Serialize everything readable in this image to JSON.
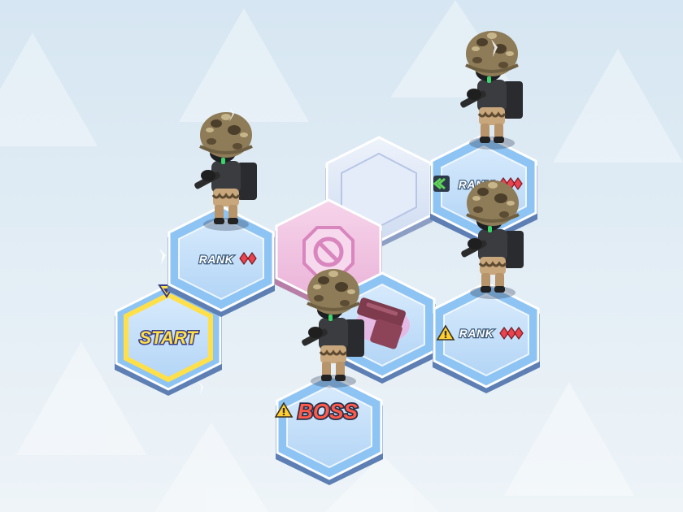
{
  "colors": {
    "background": "#dfeaf3",
    "tile_blue": "#8ec4f3",
    "tile_start": "#ffe04a",
    "tile_pink": "#f1b6dc",
    "rank_pip": "#e8434f",
    "promote_chevron": "#5fd35a",
    "warning": "#ffcf33",
    "boss_text": "#ff5a4a"
  },
  "map": {
    "start_label": "START",
    "boss_label": "BOSS",
    "rank_label": "RANK",
    "nodes": [
      {
        "id": "start",
        "type": "start-node",
        "label": "START"
      },
      {
        "id": "enemy-left",
        "type": "enemy-node",
        "rank_label": "RANK",
        "rank_pips": 2
      },
      {
        "id": "empty-top",
        "type": "empty-node"
      },
      {
        "id": "blocked",
        "type": "blocked-node",
        "icon": "no-entry-icon"
      },
      {
        "id": "weapon",
        "type": "reward-node",
        "icon": "weapon-crate-icon"
      },
      {
        "id": "boss",
        "type": "boss-node",
        "label": "BOSS",
        "badge": "warning-icon"
      },
      {
        "id": "enemy-top-right",
        "type": "enemy-node",
        "rank_label": "RANK",
        "rank_pips": 3,
        "badge": "chevron-up-icon"
      },
      {
        "id": "enemy-right",
        "type": "enemy-node",
        "rank_label": "RANK",
        "rank_pips": 3,
        "badge": "warning-icon"
      }
    ]
  }
}
